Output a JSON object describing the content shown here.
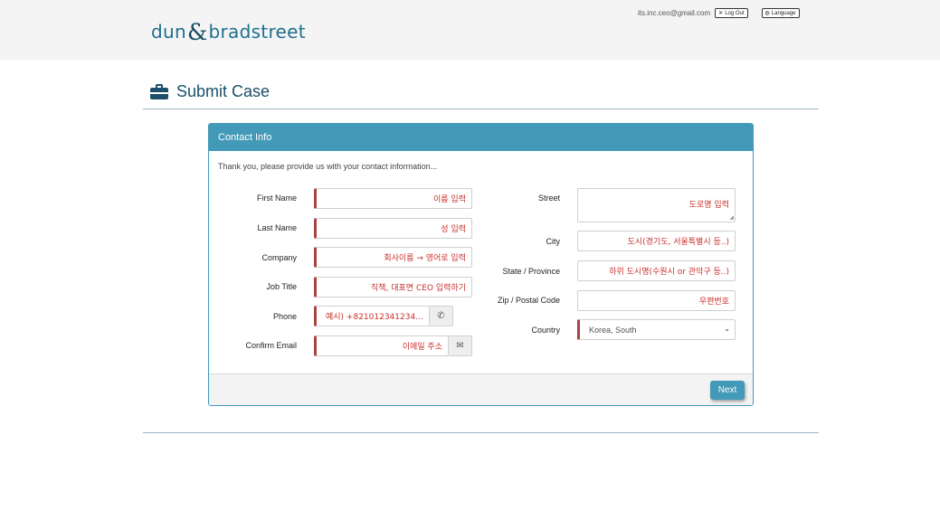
{
  "header": {
    "logo_left": "dun",
    "logo_amp": "&",
    "logo_right": "bradstreet",
    "user_email": "its.inc.ceo@gmail.com",
    "logout_label": "Log Out",
    "language_label": "Language"
  },
  "page": {
    "title": "Submit Case"
  },
  "panel": {
    "title": "Contact Info",
    "intro": "Thank you, please provide us with your contact information...",
    "next_label": "Next"
  },
  "left_fields": {
    "first_name": {
      "label": "First Name",
      "value": "이름 입력"
    },
    "last_name": {
      "label": "Last Name",
      "value": "성 입력"
    },
    "company": {
      "label": "Company",
      "value": "회사이름 → 영어로 입력"
    },
    "job_title": {
      "label": "Job Title",
      "value": "직책, 대표면 CEO 입력하기"
    },
    "phone": {
      "label": "Phone",
      "value": "예시) +821012341234..."
    },
    "confirm_email": {
      "label": "Confirm Email",
      "value": "이메일 주소"
    }
  },
  "right_fields": {
    "street": {
      "label": "Street",
      "value": "도로명 입력"
    },
    "city": {
      "label": "City",
      "value": "도시(경기도, 서울특별시 등..)"
    },
    "state": {
      "label": "State / Province",
      "value": "하위 도시명(수원시 or 관악구 등..)"
    },
    "zip": {
      "label": "Zip / Postal Code",
      "value": "우편번호"
    },
    "country": {
      "label": "Country",
      "value": "Korea, South"
    }
  },
  "colors": {
    "accent": "#4399b8",
    "title": "#1b4f6b",
    "required_bar": "#a94442",
    "value_text": "#c9302c"
  }
}
